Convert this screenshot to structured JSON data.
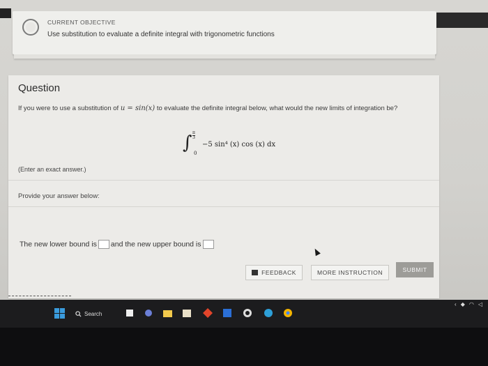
{
  "objective": {
    "label": "CURRENT OBJECTIVE",
    "text": "Use substitution to evaluate a definite integral with trigonometric functions"
  },
  "question": {
    "title": "Question",
    "text_before": "If you were to use a substitution of ",
    "math_sub": "u = sin(x)",
    "text_after": " to evaluate the definite integral below, what would the new limits of integration be?",
    "integral": {
      "upper_num": "π",
      "upper_den": "3",
      "lower": "0",
      "integrand": "−5 sin⁴ (x) cos (x) dx"
    },
    "note": "(Enter an exact answer.)"
  },
  "answer": {
    "prompt": "Provide your answer below:",
    "part1": "The new lower bound is",
    "part2": "and the new upper bound is"
  },
  "buttons": {
    "feedback": "FEEDBACK",
    "more": "MORE INSTRUCTION",
    "submit": "SUBMIT"
  },
  "taskbar": {
    "search_label": "Search"
  },
  "colors": {
    "card_bg": "#ecebe8",
    "submit_bg": "#9d9c98",
    "taskbar_bg": "#1c1c1e"
  }
}
